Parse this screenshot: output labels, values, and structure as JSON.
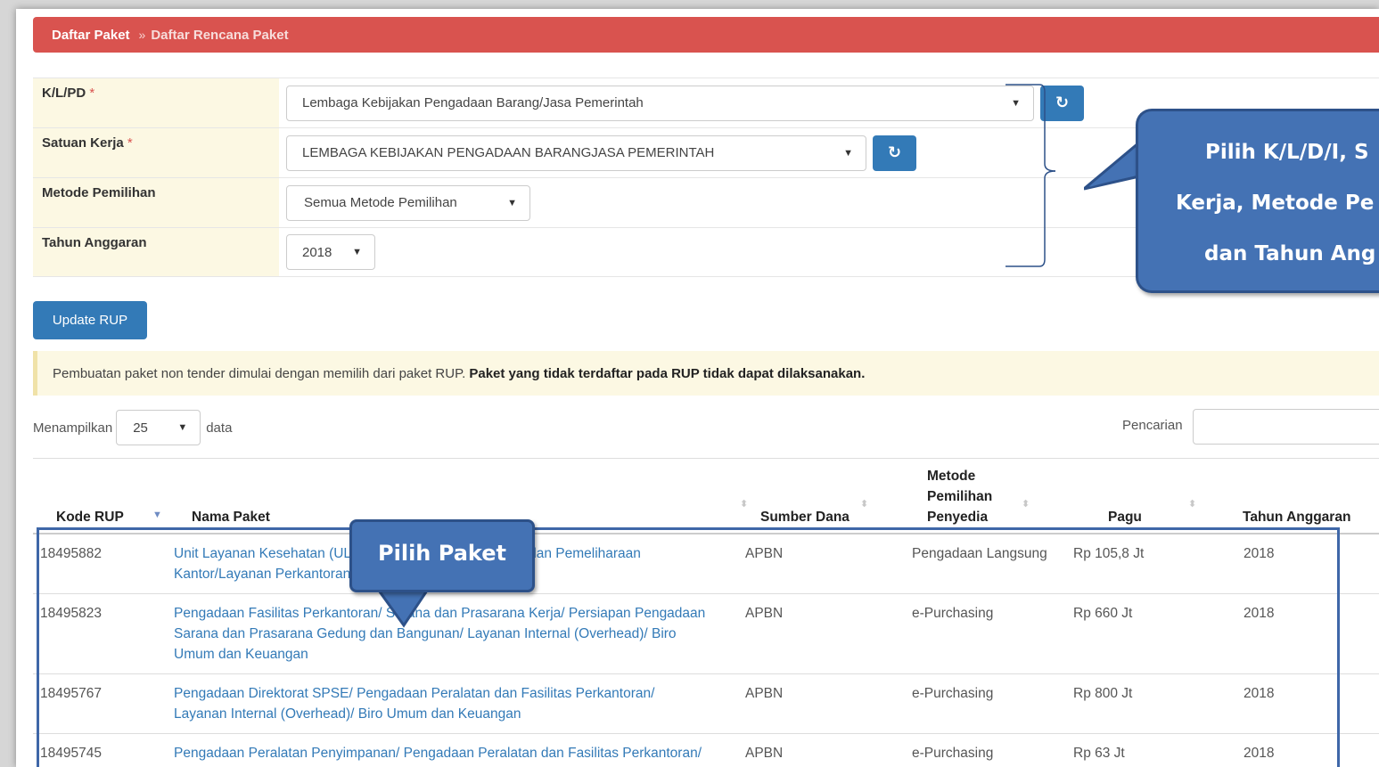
{
  "breadcrumb": {
    "first": "Daftar Paket",
    "separator": "»",
    "current": "Daftar Rencana Paket"
  },
  "form": {
    "klpd": {
      "label": "K/L/PD",
      "required": "*",
      "value": "Lembaga Kebijakan Pengadaan Barang/Jasa Pemerintah"
    },
    "satker": {
      "label": "Satuan Kerja",
      "required": "*",
      "value": "LEMBAGA KEBIJAKAN PENGADAAN BARANGJASA PEMERINTAH"
    },
    "metode": {
      "label": "Metode Pemilihan",
      "value": "Semua Metode Pemilihan"
    },
    "tahun": {
      "label": "Tahun Anggaran",
      "value": "2018"
    }
  },
  "update_button": "Update RUP",
  "alert": {
    "text": "Pembuatan paket non tender dimulai dengan memilih dari paket RUP.",
    "bold": "Paket yang tidak terdaftar pada RUP tidak dapat dilaksanakan."
  },
  "length": {
    "prefix": "Menampilkan",
    "value": "25",
    "suffix": "data"
  },
  "search": {
    "label": "Pencarian",
    "value": ""
  },
  "table": {
    "headers": {
      "kode": "Kode RUP",
      "nama": "Nama Paket",
      "dana": "Sumber Dana",
      "metode_l1": "Metode",
      "metode_l2": "Pemilihan",
      "metode_l3": "Penyedia",
      "pagu": "Pagu",
      "tahun": "Tahun Anggaran"
    },
    "rows": [
      {
        "kode": "18495882",
        "nama": "Unit Layanan Kesehatan (ULK)/ Pengadaan Barang/Jasa dan Pemeliharaan Kantor/Layanan Perkantoran/ Biro Umum dan Keuangan",
        "dana": "APBN",
        "metode": "Pengadaan Langsung",
        "pagu": "Rp 105,8 Jt",
        "tahun": "2018"
      },
      {
        "kode": "18495823",
        "nama": "Pengadaan Fasilitas Perkantoran/ Sarana dan Prasarana Kerja/ Persiapan Pengadaan Sarana dan Prasarana Gedung dan Bangunan/ Layanan Internal (Overhead)/ Biro Umum dan Keuangan",
        "dana": "APBN",
        "metode": "e-Purchasing",
        "pagu": "Rp 660 Jt",
        "tahun": "2018"
      },
      {
        "kode": "18495767",
        "nama": "Pengadaan Direktorat SPSE/ Pengadaan Peralatan dan Fasilitas Perkantoran/ Layanan Internal (Overhead)/ Biro Umum dan Keuangan",
        "dana": "APBN",
        "metode": "e-Purchasing",
        "pagu": "Rp 800 Jt",
        "tahun": "2018"
      },
      {
        "kode": "18495745",
        "nama": "Pengadaan Peralatan Penyimpanan/ Pengadaan Peralatan dan Fasilitas Perkantoran/ Layanan Internal (Overhead)/ Biro Umum dan Keuangan",
        "dana": "APBN",
        "metode": "e-Purchasing",
        "pagu": "Rp 63 Jt",
        "tahun": "2018"
      }
    ]
  },
  "callouts": {
    "paket": "Pilih Paket",
    "pilih_l1": "Pilih K/L/D/I, S",
    "pilih_l2": "Kerja, Metode Pe",
    "pilih_l3": "dan Tahun Ang"
  },
  "colors": {
    "breadcrumb": "#d9534f",
    "primary": "#337ab7",
    "callout": "#4472b4",
    "label_bg": "#fcf8e3"
  }
}
